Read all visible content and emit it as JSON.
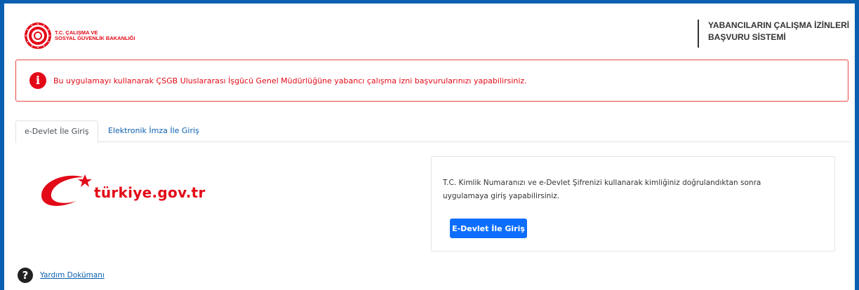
{
  "header": {
    "ministry_line1": "T.C. ÇALIŞMA VE",
    "ministry_line2": "SOSYAL GÜVENLİK BAKANLIĞI",
    "system_title_line1": "YABANCILARIN ÇALIŞMA İZİNLERİ",
    "system_title_line2": "BAŞVURU SİSTEMİ",
    "logo_icon": "ministry-seal-icon"
  },
  "alert": {
    "icon": "info-icon",
    "icon_glyph": "i",
    "message": "Bu uygulamayı kullanarak ÇSGB Uluslararası İşgücü Genel Müdürlüğüne yabancı çalışma izni başvurularınızı yapabilirsiniz.",
    "color": "#e30a17"
  },
  "tabs": [
    {
      "label": "e-Devlet İle Giriş",
      "active": true
    },
    {
      "label": "Elektronik İmza İle Giriş",
      "active": false
    }
  ],
  "edevlet": {
    "logo_text": "türkiye.gov.tr",
    "description": "T.C. Kimlik Numaranızı ve e-Devlet Şifrenizi kullanarak kimliğiniz doğrulandıktan sonra uygulamaya giriş yapabilirsiniz.",
    "button_label": "E-Devlet İle Giriş"
  },
  "help": {
    "icon": "question-circle-icon",
    "icon_glyph": "?",
    "link_label": "Yardım Dokümanı"
  },
  "colors": {
    "brand_red": "#e30a17",
    "frame_blue": "#0a5fb0",
    "button_blue": "#0d6efd"
  }
}
